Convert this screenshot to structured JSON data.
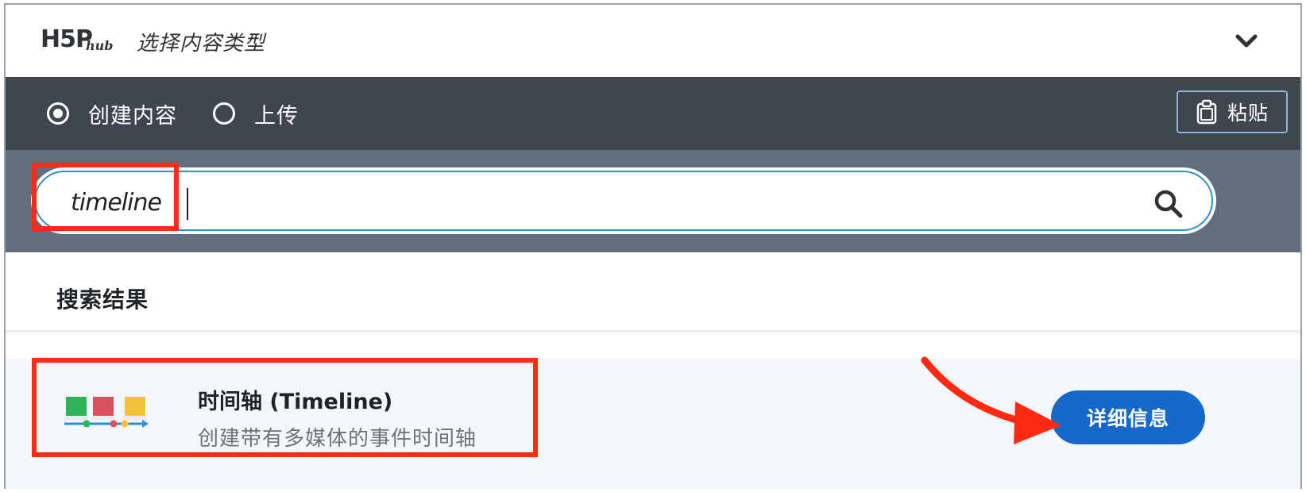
{
  "header": {
    "logo_text": "H5P",
    "logo_sub": "hub",
    "title": "选择内容类型"
  },
  "mode_bar": {
    "options": [
      {
        "label": "创建内容",
        "selected": true
      },
      {
        "label": "上传",
        "selected": false
      }
    ],
    "paste_label": "粘贴"
  },
  "search": {
    "value": "timeline",
    "placeholder": ""
  },
  "results": {
    "heading": "搜索结果",
    "items": [
      {
        "title": "时间轴 (Timeline)",
        "description": "创建带有多媒体的事件时间轴",
        "details_label": "详细信息"
      }
    ]
  },
  "colors": {
    "mode_bar_bg": "#3f464f",
    "search_bar_bg": "#626d7d",
    "accent_blue": "#1769c9",
    "annotation_red": "#ff2a12"
  }
}
